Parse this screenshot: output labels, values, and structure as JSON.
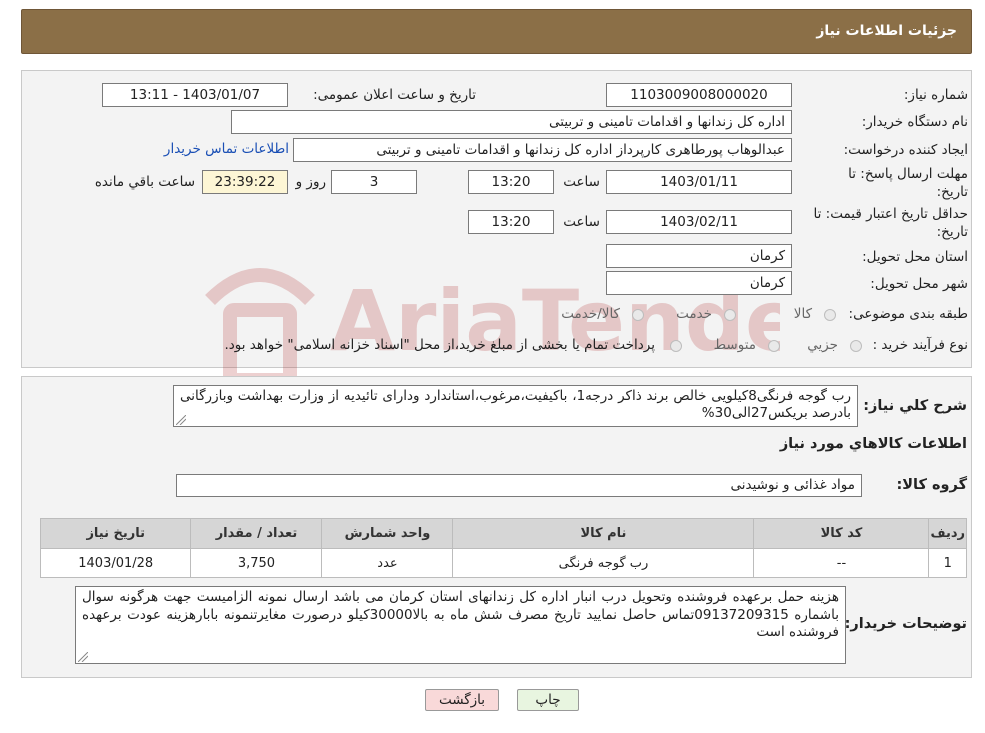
{
  "header": {
    "title": "جزئیات اطلاعات نیاز"
  },
  "fields": {
    "need_number_label": "شماره نیاز:",
    "need_number": "1103009008000020",
    "announce_label": "تاریخ و ساعت اعلان عمومی:",
    "announce_value": "1403/01/07 - 13:11",
    "buyer_org_label": "نام دستگاه خریدار:",
    "buyer_org": "اداره کل زندانها و اقدامات تامینی و تربیتی",
    "creator_label": "ایجاد کننده درخواست:",
    "creator": "عبدالوهاب پورطاهری کارپرداز اداره کل زندانها و اقدامات تامینی و تربیتی",
    "contact_link": "اطلاعات تماس خریدار",
    "deadline_label": "مهلت ارسال پاسخ: تا تاریخ:",
    "deadline_date": "1403/01/11",
    "time_label": "ساعت",
    "deadline_time": "13:20",
    "days_value": "3",
    "days_label": "روز و",
    "remaining_time": "23:39:22",
    "remaining_label": "ساعت باقي مانده",
    "validity_label": "حداقل تاريخ اعتبار قيمت: تا تاریخ:",
    "validity_date": "1403/02/11",
    "validity_time": "13:20",
    "province_label": "استان محل تحویل:",
    "province": "کرمان",
    "city_label": "شهر محل تحویل:",
    "city": "کرمان",
    "category_label": "طبقه بندی موضوعی:",
    "category_options": [
      "کالا",
      "خدمت",
      "کالا/خدمت"
    ],
    "process_label": "نوع فرآیند خرید :",
    "process_options": [
      "جزيي",
      "متوسط"
    ],
    "process_note": "پرداخت تمام یا بخشی از مبلغ خرید،از محل \"اسناد خزانه اسلامی\" خواهد بود."
  },
  "description": {
    "label": "شرح کلي نياز:",
    "text": "رب گوجه فرنگی8کیلویی خالص برند ذاکر درجه1، باکیفیت،مرغوب،استاندارد ودارای تائیدیه از وزارت بهداشت وبازرگانی بادرصد بریکس27الی30%"
  },
  "goods": {
    "section_title": "اطلاعات کالاهاي مورد نياز",
    "group_label": "گروه کالا:",
    "group_value": "مواد غذائی و نوشیدنی",
    "columns": [
      "رديف",
      "کد کالا",
      "نام کالا",
      "واحد شمارش",
      "تعداد / مقدار",
      "تاريخ نياز"
    ],
    "rows": [
      {
        "index": "1",
        "code": "--",
        "name": "رب گوجه فرنگی",
        "unit": "عدد",
        "qty": "3,750",
        "date": "1403/01/28"
      }
    ]
  },
  "buyer_notes": {
    "label": "توضیحات خریدار:",
    "text": "هزینه حمل برعهده فروشنده وتحویل درب انبار اداره کل زندانهای استان کرمان می باشد ارسال نمونه الزامیست جهت هرگونه سوال باشماره 09137209315تماس حاصل نمایید تاریخ مصرف شش ماه به بالا30000کیلو درصورت مغایرتنمونه بابارهزینه عودت برعهده فروشنده است"
  },
  "buttons": {
    "print": "چاپ",
    "back": "بازگشت"
  },
  "watermark": {
    "text": "AriaTender.neT"
  },
  "colors": {
    "header_bg": "#8B6F47",
    "link": "#1a4fb5",
    "back_button": "#f9d9d9",
    "print_button": "#e8f5e0"
  }
}
